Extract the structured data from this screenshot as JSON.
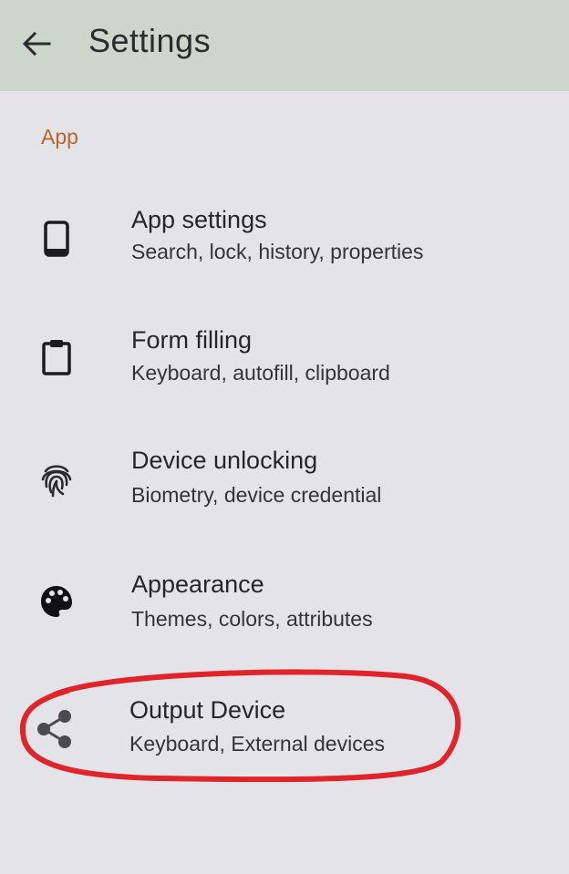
{
  "app_bar": {
    "title": "Settings",
    "back_icon": "arrow-left-icon"
  },
  "section": {
    "label": "App"
  },
  "items": [
    {
      "title": "App settings",
      "subtitle": "Search, lock, history, properties",
      "icon": "phone-icon"
    },
    {
      "title": "Form filling",
      "subtitle": "Keyboard, autofill, clipboard",
      "icon": "clipboard-icon"
    },
    {
      "title": "Device unlocking",
      "subtitle": "Biometry, device credential",
      "icon": "fingerprint-icon"
    },
    {
      "title": "Appearance",
      "subtitle": "Themes, colors, attributes",
      "icon": "palette-icon"
    },
    {
      "title": "Output Device",
      "subtitle": "Keyboard, External devices",
      "icon": "share-icon"
    }
  ],
  "colors": {
    "app_bar": "#cdd6cb",
    "background": "#e4e3e8",
    "section_header": "#b8662d",
    "highlight_annotation": "#e0242a"
  }
}
